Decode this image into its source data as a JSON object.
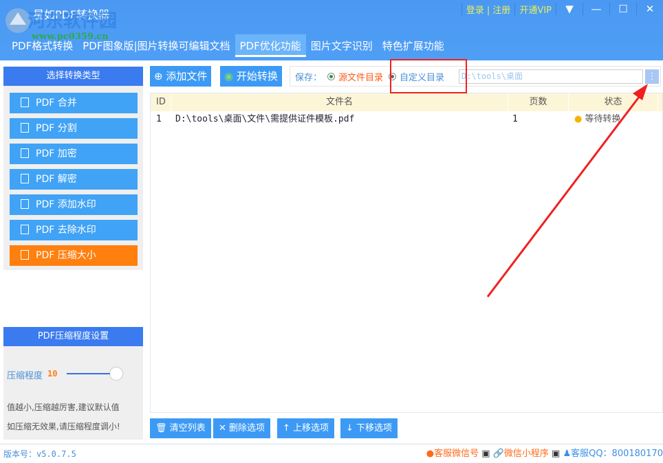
{
  "app": {
    "title": "星如PDF转换器",
    "watermark": "河东软件园",
    "watermark_url": "www.pc0359.cn"
  },
  "topbar": {
    "login": "登录",
    "register": "注册",
    "sep": "|",
    "vip": "开通VIP"
  },
  "tabs": [
    "PDF格式转换",
    "PDF图象版|图片转换可编辑文档",
    "PDF优化功能",
    "图片文字识别",
    "特色扩展功能"
  ],
  "sidebar": {
    "title": "选择转换类型",
    "items": [
      "PDF 合并",
      "PDF 分割",
      "PDF 加密",
      "PDF 解密",
      "PDF 添加水印",
      "PDF 去除水印",
      "PDF 压缩大小"
    ]
  },
  "compress": {
    "title": "PDF压缩程度设置",
    "label": "压缩程度",
    "value": "10",
    "level": 1.0,
    "hint1": "值越小,压缩越厉害,建议默认值",
    "hint2": "如压缩无效果,请压缩程度调小!"
  },
  "toolbar": {
    "add": "添加文件",
    "start": "开始转换",
    "save_label": "保存：",
    "opt_source": "源文件目录",
    "opt_custom": "自定义目录",
    "path": "D:\\tools\\桌面"
  },
  "table": {
    "headers": [
      "ID",
      "文件名",
      "页数",
      "状态"
    ],
    "rows": [
      {
        "id": "1",
        "name": "D:\\tools\\桌面\\文件\\需提供证件模板.pdf",
        "pages": "1",
        "status": "等待转换"
      }
    ]
  },
  "bottom": {
    "clear": "清空列表",
    "delete": "删除选项",
    "up": "上移选项",
    "down": "下移选项"
  },
  "footer": {
    "version": "版本号：v5.0.7.5",
    "wechat": "客服微信号",
    "mini": "微信小程序",
    "qq": "客服QQ：800180170"
  }
}
